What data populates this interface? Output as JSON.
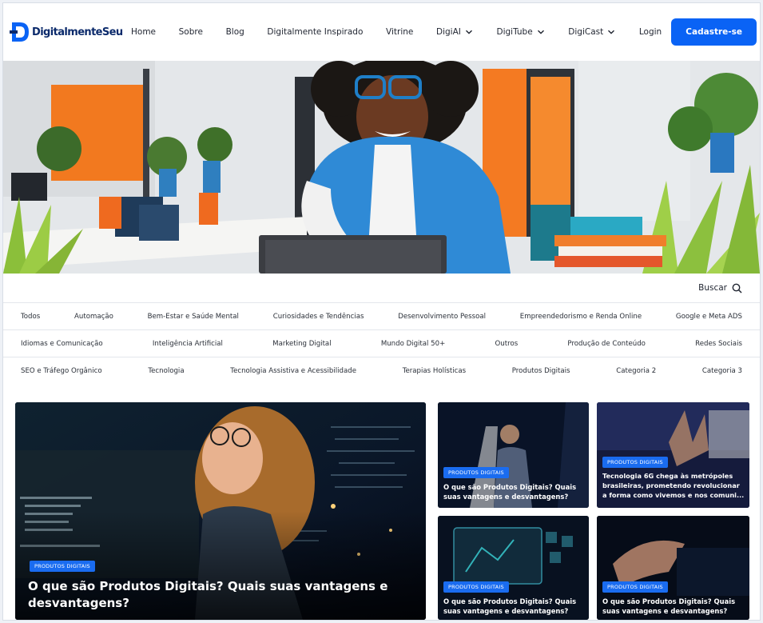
{
  "header": {
    "logo_text": "DigitalmenteSeu",
    "nav": [
      {
        "label": "Home"
      },
      {
        "label": "Sobre"
      },
      {
        "label": "Blog"
      },
      {
        "label": "Digitalmente Inspirado"
      },
      {
        "label": "Vitrine"
      },
      {
        "label": "DigiAI"
      },
      {
        "label": "DigiTube"
      },
      {
        "label": "DigiCast"
      },
      {
        "label": "Login"
      }
    ],
    "cta_label": "Cadastre-se"
  },
  "search": {
    "label": "Buscar"
  },
  "categories": {
    "row1": [
      "Todos",
      "Automação",
      "Bem-Estar e Saúde Mental",
      "Curiosidades e Tendências",
      "Desenvolvimento Pessoal",
      "Empreendedorismo e Renda Online",
      "Google e Meta ADS"
    ],
    "row2": [
      "Idiomas e Comunicação",
      "Inteligência Artificial",
      "Marketing Digital",
      "Mundo Digital 50+",
      "Outros",
      "Produção de Conteúdo",
      "Redes Sociais"
    ],
    "row3": [
      "SEO e Tráfego Orgânico",
      "Tecnologia",
      "Tecnologia Assistiva e Acessibilidade",
      "Terapias Holísticas",
      "Produtos Digitais",
      "Categoria 2",
      "Categoria 3"
    ]
  },
  "posts": {
    "featured": {
      "badge": "Produtos Digitais",
      "title_line1": "O que são Produtos Digitais? Quais suas vantagens e",
      "title_line2": "desvantagens?"
    },
    "small": [
      {
        "badge": "Produtos Digitais",
        "title_line1": "O que são Produtos Digitais? Quais",
        "title_line2": "suas vantagens e desvantagens?",
        "title_line3": ""
      },
      {
        "badge": "Produtos Digitais",
        "title_line1": "Tecnologia 6G chega às metrópoles",
        "title_line2": "brasileiras, prometendo revolucionar",
        "title_line3": "a forma como vivemos e nos comuni..."
      },
      {
        "badge": "Produtos Digitais",
        "title_line1": "O que são Produtos Digitais? Quais",
        "title_line2": "suas vantagens e desvantagens?",
        "title_line3": ""
      },
      {
        "badge": "Produtos Digitais",
        "title_line1": "O que são Produtos Digitais? Quais",
        "title_line2": "suas vantagens e desvantagens?",
        "title_line3": ""
      }
    ]
  },
  "colors": {
    "accent": "#0a63f5",
    "badge": "#1a6cf0",
    "logo": "#0b2a6b"
  }
}
